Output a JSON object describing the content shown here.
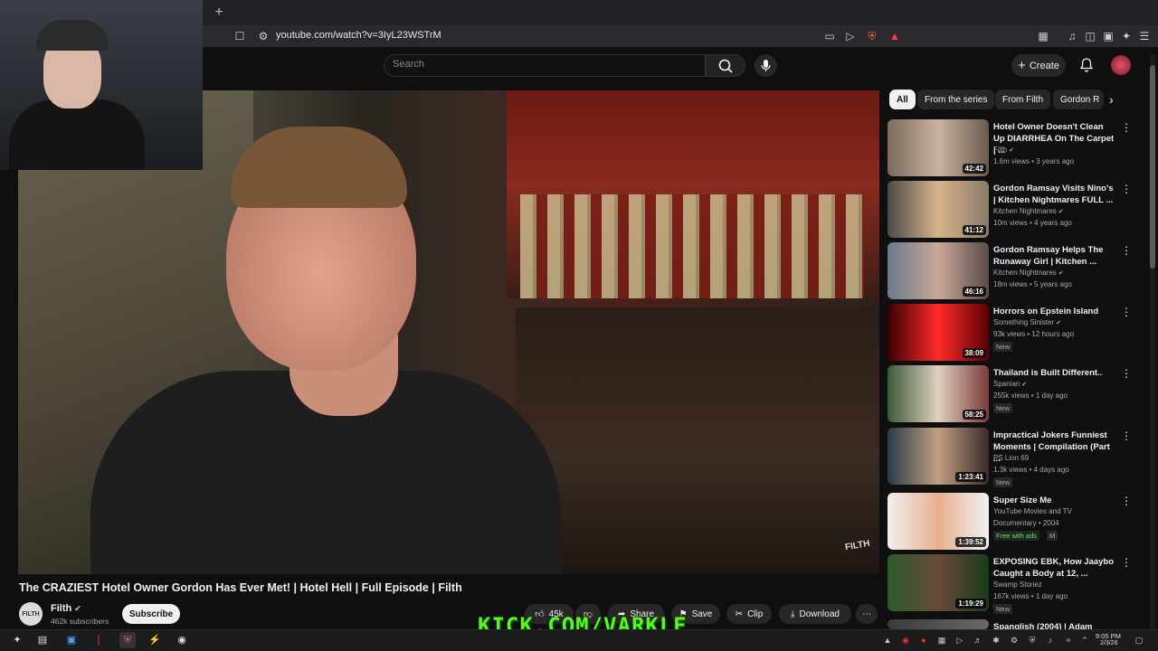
{
  "browser": {
    "url": "youtube.com/watch?v=3IyL23WSTrM",
    "new_tab": "+"
  },
  "header": {
    "search_placeholder": "Search",
    "create_label": "Create"
  },
  "video": {
    "title": "The CRAZIEST Hotel Owner Gordon Has Ever Met! | Hotel Hell | Full Episode | Filth",
    "watermark": "FILTH",
    "channel": {
      "name": "Filth",
      "subscribers": "462k subscribers",
      "avatar_text": "FILTH"
    },
    "subscribe_label": "Subscribe",
    "actions": {
      "likes": "45k",
      "share": "Share",
      "save": "Save",
      "clip": "Clip",
      "download": "Download"
    },
    "overlay_text": "KICK.COM/VARKLE"
  },
  "sidebar": {
    "chips": [
      "All",
      "From the series",
      "From Filth",
      "Gordon R"
    ],
    "recommendations": [
      {
        "title": "Hotel Owner Doesn't Clean Up DIARRHEA On The Carpet | ...",
        "channel": "Filth",
        "meta": "1.6m views • 3 years ago",
        "duration": "42:42",
        "badge": "",
        "verified": true
      },
      {
        "title": "Gordon Ramsay Visits Nino's | Kitchen Nightmares FULL ...",
        "channel": "Kitchen Nightmares",
        "meta": "10m views • 4 years ago",
        "duration": "41:12",
        "badge": "",
        "verified": true
      },
      {
        "title": "Gordon Ramsay Helps The Runaway Girl | Kitchen ...",
        "channel": "Kitchen Nightmares",
        "meta": "18m views • 5 years ago",
        "duration": "46:16",
        "badge": "",
        "verified": true
      },
      {
        "title": "Horrors on Epstein Island",
        "channel": "Something Sinister",
        "meta": "93k views • 12 hours ago",
        "duration": "38:09",
        "badge": "New",
        "verified": true
      },
      {
        "title": "Thailand is Built Different..",
        "channel": "Spanian",
        "meta": "255k views • 1 day ago",
        "duration": "58:25",
        "badge": "New",
        "verified": true
      },
      {
        "title": "Impractical Jokers Funniest Moments | Compilation (Part ...",
        "channel": "PS Lion 69",
        "meta": "1.3k views • 4 days ago",
        "duration": "1:23:41",
        "badge": "New",
        "verified": false
      },
      {
        "title": "Super Size Me",
        "channel": "YouTube Movies and TV",
        "meta": "Documentary • 2004",
        "duration": "1:39:52",
        "badge": "Free with ads",
        "badge2": "M",
        "verified": false
      },
      {
        "title": "EXPOSING EBK, How Jaaybo Caught a Body at 12, ...",
        "channel": "Swamp Storiez",
        "meta": "167k views • 1 day ago",
        "duration": "1:19:29",
        "badge": "New",
        "verified": false
      },
      {
        "title": "Spanglish (2004) | Adam",
        "channel": "",
        "meta": "",
        "duration": "",
        "badge": "",
        "verified": false
      }
    ]
  },
  "taskbar": {
    "time": "9:05 PM",
    "date": "2/3/26"
  },
  "colors": {
    "accent_red": "#ff0000",
    "kick_green": "#53fc18",
    "background": "#0f0f0f"
  }
}
